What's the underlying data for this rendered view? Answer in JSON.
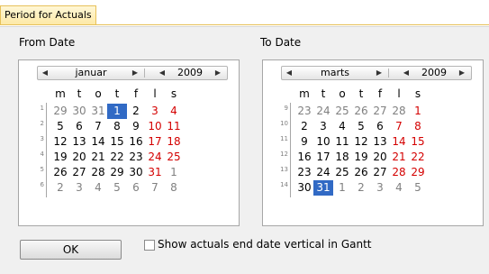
{
  "window": {
    "title": "Period for Actuals"
  },
  "from": {
    "label": "From Date",
    "month": "januar",
    "year": "2009",
    "weekdays": [
      "m",
      "t",
      "o",
      "t",
      "f",
      "l",
      "s"
    ],
    "weeks": [
      {
        "wk": "1",
        "days": [
          {
            "d": "29",
            "t": "other"
          },
          {
            "d": "30",
            "t": "other"
          },
          {
            "d": "31",
            "t": "other"
          },
          {
            "d": "1",
            "t": "sel"
          },
          {
            "d": "2",
            "t": "normal"
          },
          {
            "d": "3",
            "t": "sun"
          },
          {
            "d": "4",
            "t": "sun"
          }
        ]
      },
      {
        "wk": "2",
        "days": [
          {
            "d": "5",
            "t": "normal"
          },
          {
            "d": "6",
            "t": "normal"
          },
          {
            "d": "7",
            "t": "normal"
          },
          {
            "d": "8",
            "t": "normal"
          },
          {
            "d": "9",
            "t": "normal"
          },
          {
            "d": "10",
            "t": "sun"
          },
          {
            "d": "11",
            "t": "sun"
          }
        ]
      },
      {
        "wk": "3",
        "days": [
          {
            "d": "12",
            "t": "normal"
          },
          {
            "d": "13",
            "t": "normal"
          },
          {
            "d": "14",
            "t": "normal"
          },
          {
            "d": "15",
            "t": "normal"
          },
          {
            "d": "16",
            "t": "normal"
          },
          {
            "d": "17",
            "t": "sun"
          },
          {
            "d": "18",
            "t": "sun"
          }
        ]
      },
      {
        "wk": "4",
        "days": [
          {
            "d": "19",
            "t": "normal"
          },
          {
            "d": "20",
            "t": "normal"
          },
          {
            "d": "21",
            "t": "normal"
          },
          {
            "d": "22",
            "t": "normal"
          },
          {
            "d": "23",
            "t": "normal"
          },
          {
            "d": "24",
            "t": "sun"
          },
          {
            "d": "25",
            "t": "sun"
          }
        ]
      },
      {
        "wk": "5",
        "days": [
          {
            "d": "26",
            "t": "normal"
          },
          {
            "d": "27",
            "t": "normal"
          },
          {
            "d": "28",
            "t": "normal"
          },
          {
            "d": "29",
            "t": "normal"
          },
          {
            "d": "30",
            "t": "normal"
          },
          {
            "d": "31",
            "t": "sun"
          },
          {
            "d": "1",
            "t": "other"
          }
        ]
      },
      {
        "wk": "6",
        "days": [
          {
            "d": "2",
            "t": "other"
          },
          {
            "d": "3",
            "t": "other"
          },
          {
            "d": "4",
            "t": "other"
          },
          {
            "d": "5",
            "t": "other"
          },
          {
            "d": "6",
            "t": "other"
          },
          {
            "d": "7",
            "t": "other"
          },
          {
            "d": "8",
            "t": "other"
          }
        ]
      }
    ]
  },
  "to": {
    "label": "To Date",
    "month": "marts",
    "year": "2009",
    "weekdays": [
      "m",
      "t",
      "o",
      "t",
      "f",
      "l",
      "s"
    ],
    "weeks": [
      {
        "wk": "9",
        "days": [
          {
            "d": "23",
            "t": "other"
          },
          {
            "d": "24",
            "t": "other"
          },
          {
            "d": "25",
            "t": "other"
          },
          {
            "d": "26",
            "t": "other"
          },
          {
            "d": "27",
            "t": "other"
          },
          {
            "d": "28",
            "t": "other"
          },
          {
            "d": "1",
            "t": "sun"
          }
        ]
      },
      {
        "wk": "10",
        "days": [
          {
            "d": "2",
            "t": "normal"
          },
          {
            "d": "3",
            "t": "normal"
          },
          {
            "d": "4",
            "t": "normal"
          },
          {
            "d": "5",
            "t": "normal"
          },
          {
            "d": "6",
            "t": "normal"
          },
          {
            "d": "7",
            "t": "sun"
          },
          {
            "d": "8",
            "t": "sun"
          }
        ]
      },
      {
        "wk": "11",
        "days": [
          {
            "d": "9",
            "t": "normal"
          },
          {
            "d": "10",
            "t": "normal"
          },
          {
            "d": "11",
            "t": "normal"
          },
          {
            "d": "12",
            "t": "normal"
          },
          {
            "d": "13",
            "t": "normal"
          },
          {
            "d": "14",
            "t": "sun"
          },
          {
            "d": "15",
            "t": "sun"
          }
        ]
      },
      {
        "wk": "12",
        "days": [
          {
            "d": "16",
            "t": "normal"
          },
          {
            "d": "17",
            "t": "normal"
          },
          {
            "d": "18",
            "t": "normal"
          },
          {
            "d": "19",
            "t": "normal"
          },
          {
            "d": "20",
            "t": "normal"
          },
          {
            "d": "21",
            "t": "sun"
          },
          {
            "d": "22",
            "t": "sun"
          }
        ]
      },
      {
        "wk": "13",
        "days": [
          {
            "d": "23",
            "t": "normal"
          },
          {
            "d": "24",
            "t": "normal"
          },
          {
            "d": "25",
            "t": "normal"
          },
          {
            "d": "26",
            "t": "normal"
          },
          {
            "d": "27",
            "t": "normal"
          },
          {
            "d": "28",
            "t": "sun"
          },
          {
            "d": "29",
            "t": "sun"
          }
        ]
      },
      {
        "wk": "14",
        "days": [
          {
            "d": "30",
            "t": "normal"
          },
          {
            "d": "31",
            "t": "sel"
          },
          {
            "d": "1",
            "t": "other"
          },
          {
            "d": "2",
            "t": "other"
          },
          {
            "d": "3",
            "t": "other"
          },
          {
            "d": "4",
            "t": "other"
          },
          {
            "d": "5",
            "t": "other"
          }
        ]
      }
    ]
  },
  "footer": {
    "ok_label": "OK",
    "checkbox_label": "Show actuals end date vertical in Gantt",
    "checkbox_checked": false
  },
  "colors": {
    "selected": "#316ac5",
    "weekend": "#d40000",
    "other_month": "#808080",
    "title_tab": "#fde9a7"
  },
  "icons": {
    "prev": "triangle-left-icon",
    "next": "triangle-right-icon"
  }
}
